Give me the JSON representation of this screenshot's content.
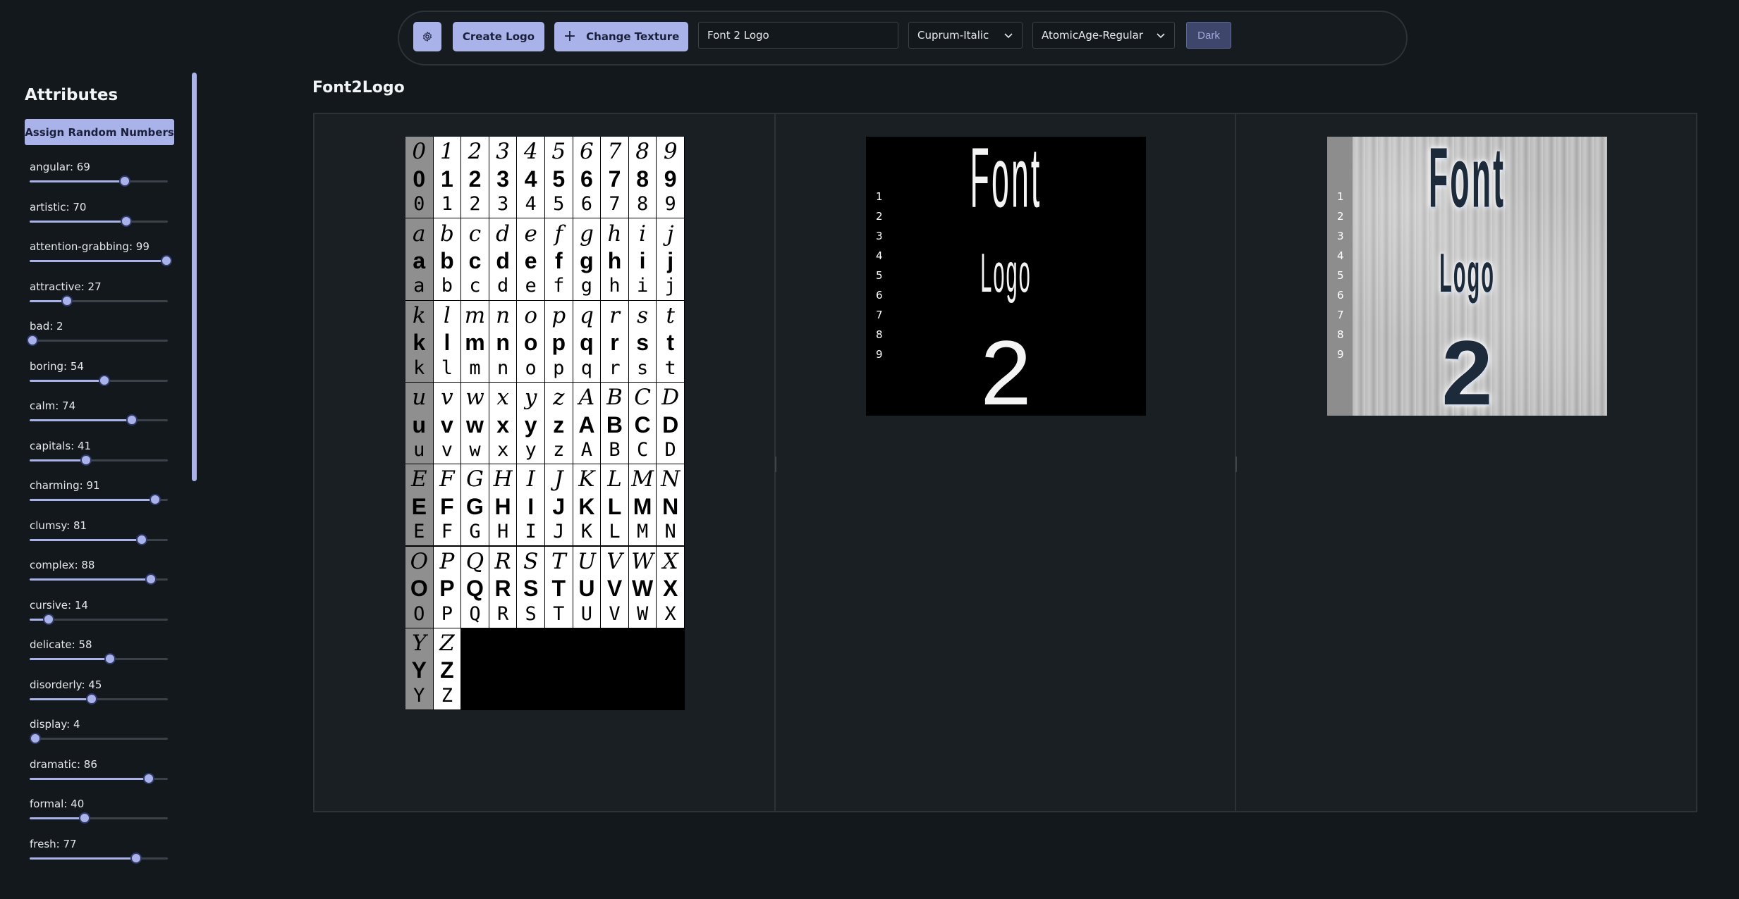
{
  "toolbar": {
    "gear_icon": "gear-icon",
    "create_label": "Create Logo",
    "texture_label": "Change Texture",
    "texture_icon": "plus-icon",
    "text_value": "Font 2 Logo",
    "font1": "Cuprum-Italic",
    "font2": "AtomicAge-Regular",
    "theme_label": "Dark"
  },
  "sidebar": {
    "title": "Attributes",
    "random_button": "Assign Random Numbers",
    "attributes": [
      {
        "name": "angular",
        "value": 69,
        "label": "angular: 69"
      },
      {
        "name": "artistic",
        "value": 70,
        "label": "artistic: 70"
      },
      {
        "name": "attention-grabbing",
        "value": 99,
        "label": "attention-grabbing: 99"
      },
      {
        "name": "attractive",
        "value": 27,
        "label": "attractive: 27"
      },
      {
        "name": "bad",
        "value": 2,
        "label": "bad: 2"
      },
      {
        "name": "boring",
        "value": 54,
        "label": "boring: 54"
      },
      {
        "name": "calm",
        "value": 74,
        "label": "calm: 74"
      },
      {
        "name": "capitals",
        "value": 41,
        "label": "capitals: 41"
      },
      {
        "name": "charming",
        "value": 91,
        "label": "charming: 91"
      },
      {
        "name": "clumsy",
        "value": 81,
        "label": "clumsy: 81"
      },
      {
        "name": "complex",
        "value": 88,
        "label": "complex: 88"
      },
      {
        "name": "cursive",
        "value": 14,
        "label": "cursive: 14"
      },
      {
        "name": "delicate",
        "value": 58,
        "label": "delicate: 58"
      },
      {
        "name": "disorderly",
        "value": 45,
        "label": "disorderly: 45"
      },
      {
        "name": "display",
        "value": 4,
        "label": "display: 4"
      },
      {
        "name": "dramatic",
        "value": 86,
        "label": "dramatic: 86"
      },
      {
        "name": "formal",
        "value": 40,
        "label": "formal: 40"
      },
      {
        "name": "fresh",
        "value": 77,
        "label": "fresh: 77"
      }
    ]
  },
  "main": {
    "title": "Font2Logo",
    "glyphs": [
      "0",
      "1",
      "2",
      "3",
      "4",
      "5",
      "6",
      "7",
      "8",
      "9",
      "a",
      "b",
      "c",
      "d",
      "e",
      "f",
      "g",
      "h",
      "i",
      "j",
      "k",
      "l",
      "m",
      "n",
      "o",
      "p",
      "q",
      "r",
      "s",
      "t",
      "u",
      "v",
      "w",
      "x",
      "y",
      "z",
      "A",
      "B",
      "C",
      "D",
      "E",
      "F",
      "G",
      "H",
      "I",
      "J",
      "K",
      "L",
      "M",
      "N",
      "O",
      "P",
      "Q",
      "R",
      "S",
      "T",
      "U",
      "V",
      "W",
      "X",
      "Y",
      "Z"
    ],
    "logo_lines": [
      "Font",
      "Logo",
      "2"
    ],
    "numbers": [
      "1",
      "2",
      "3",
      "4",
      "5",
      "6",
      "7",
      "8",
      "9"
    ]
  }
}
